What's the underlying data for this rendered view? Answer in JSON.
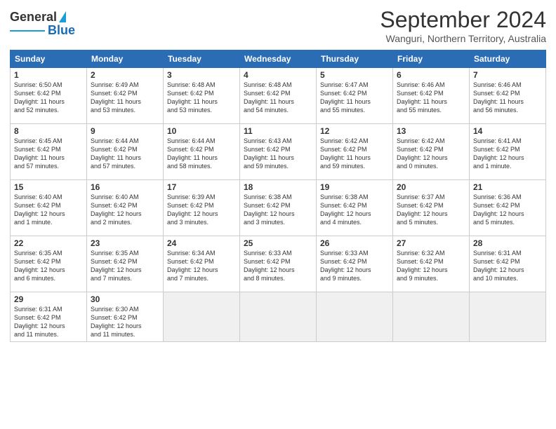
{
  "logo": {
    "line1": "General",
    "line2": "Blue"
  },
  "title": "September 2024",
  "subtitle": "Wanguri, Northern Territory, Australia",
  "days_header": [
    "Sunday",
    "Monday",
    "Tuesday",
    "Wednesday",
    "Thursday",
    "Friday",
    "Saturday"
  ],
  "weeks": [
    [
      {
        "day": "1",
        "info": "Sunrise: 6:50 AM\nSunset: 6:42 PM\nDaylight: 11 hours\nand 52 minutes."
      },
      {
        "day": "2",
        "info": "Sunrise: 6:49 AM\nSunset: 6:42 PM\nDaylight: 11 hours\nand 53 minutes."
      },
      {
        "day": "3",
        "info": "Sunrise: 6:48 AM\nSunset: 6:42 PM\nDaylight: 11 hours\nand 53 minutes."
      },
      {
        "day": "4",
        "info": "Sunrise: 6:48 AM\nSunset: 6:42 PM\nDaylight: 11 hours\nand 54 minutes."
      },
      {
        "day": "5",
        "info": "Sunrise: 6:47 AM\nSunset: 6:42 PM\nDaylight: 11 hours\nand 55 minutes."
      },
      {
        "day": "6",
        "info": "Sunrise: 6:46 AM\nSunset: 6:42 PM\nDaylight: 11 hours\nand 55 minutes."
      },
      {
        "day": "7",
        "info": "Sunrise: 6:46 AM\nSunset: 6:42 PM\nDaylight: 11 hours\nand 56 minutes."
      }
    ],
    [
      {
        "day": "8",
        "info": "Sunrise: 6:45 AM\nSunset: 6:42 PM\nDaylight: 11 hours\nand 57 minutes."
      },
      {
        "day": "9",
        "info": "Sunrise: 6:44 AM\nSunset: 6:42 PM\nDaylight: 11 hours\nand 57 minutes."
      },
      {
        "day": "10",
        "info": "Sunrise: 6:44 AM\nSunset: 6:42 PM\nDaylight: 11 hours\nand 58 minutes."
      },
      {
        "day": "11",
        "info": "Sunrise: 6:43 AM\nSunset: 6:42 PM\nDaylight: 11 hours\nand 59 minutes."
      },
      {
        "day": "12",
        "info": "Sunrise: 6:42 AM\nSunset: 6:42 PM\nDaylight: 11 hours\nand 59 minutes."
      },
      {
        "day": "13",
        "info": "Sunrise: 6:42 AM\nSunset: 6:42 PM\nDaylight: 12 hours\nand 0 minutes."
      },
      {
        "day": "14",
        "info": "Sunrise: 6:41 AM\nSunset: 6:42 PM\nDaylight: 12 hours\nand 1 minute."
      }
    ],
    [
      {
        "day": "15",
        "info": "Sunrise: 6:40 AM\nSunset: 6:42 PM\nDaylight: 12 hours\nand 1 minute."
      },
      {
        "day": "16",
        "info": "Sunrise: 6:40 AM\nSunset: 6:42 PM\nDaylight: 12 hours\nand 2 minutes."
      },
      {
        "day": "17",
        "info": "Sunrise: 6:39 AM\nSunset: 6:42 PM\nDaylight: 12 hours\nand 3 minutes."
      },
      {
        "day": "18",
        "info": "Sunrise: 6:38 AM\nSunset: 6:42 PM\nDaylight: 12 hours\nand 3 minutes."
      },
      {
        "day": "19",
        "info": "Sunrise: 6:38 AM\nSunset: 6:42 PM\nDaylight: 12 hours\nand 4 minutes."
      },
      {
        "day": "20",
        "info": "Sunrise: 6:37 AM\nSunset: 6:42 PM\nDaylight: 12 hours\nand 5 minutes."
      },
      {
        "day": "21",
        "info": "Sunrise: 6:36 AM\nSunset: 6:42 PM\nDaylight: 12 hours\nand 5 minutes."
      }
    ],
    [
      {
        "day": "22",
        "info": "Sunrise: 6:35 AM\nSunset: 6:42 PM\nDaylight: 12 hours\nand 6 minutes."
      },
      {
        "day": "23",
        "info": "Sunrise: 6:35 AM\nSunset: 6:42 PM\nDaylight: 12 hours\nand 7 minutes."
      },
      {
        "day": "24",
        "info": "Sunrise: 6:34 AM\nSunset: 6:42 PM\nDaylight: 12 hours\nand 7 minutes."
      },
      {
        "day": "25",
        "info": "Sunrise: 6:33 AM\nSunset: 6:42 PM\nDaylight: 12 hours\nand 8 minutes."
      },
      {
        "day": "26",
        "info": "Sunrise: 6:33 AM\nSunset: 6:42 PM\nDaylight: 12 hours\nand 9 minutes."
      },
      {
        "day": "27",
        "info": "Sunrise: 6:32 AM\nSunset: 6:42 PM\nDaylight: 12 hours\nand 9 minutes."
      },
      {
        "day": "28",
        "info": "Sunrise: 6:31 AM\nSunset: 6:42 PM\nDaylight: 12 hours\nand 10 minutes."
      }
    ],
    [
      {
        "day": "29",
        "info": "Sunrise: 6:31 AM\nSunset: 6:42 PM\nDaylight: 12 hours\nand 11 minutes."
      },
      {
        "day": "30",
        "info": "Sunrise: 6:30 AM\nSunset: 6:42 PM\nDaylight: 12 hours\nand 11 minutes."
      },
      {
        "day": "",
        "info": ""
      },
      {
        "day": "",
        "info": ""
      },
      {
        "day": "",
        "info": ""
      },
      {
        "day": "",
        "info": ""
      },
      {
        "day": "",
        "info": ""
      }
    ]
  ]
}
